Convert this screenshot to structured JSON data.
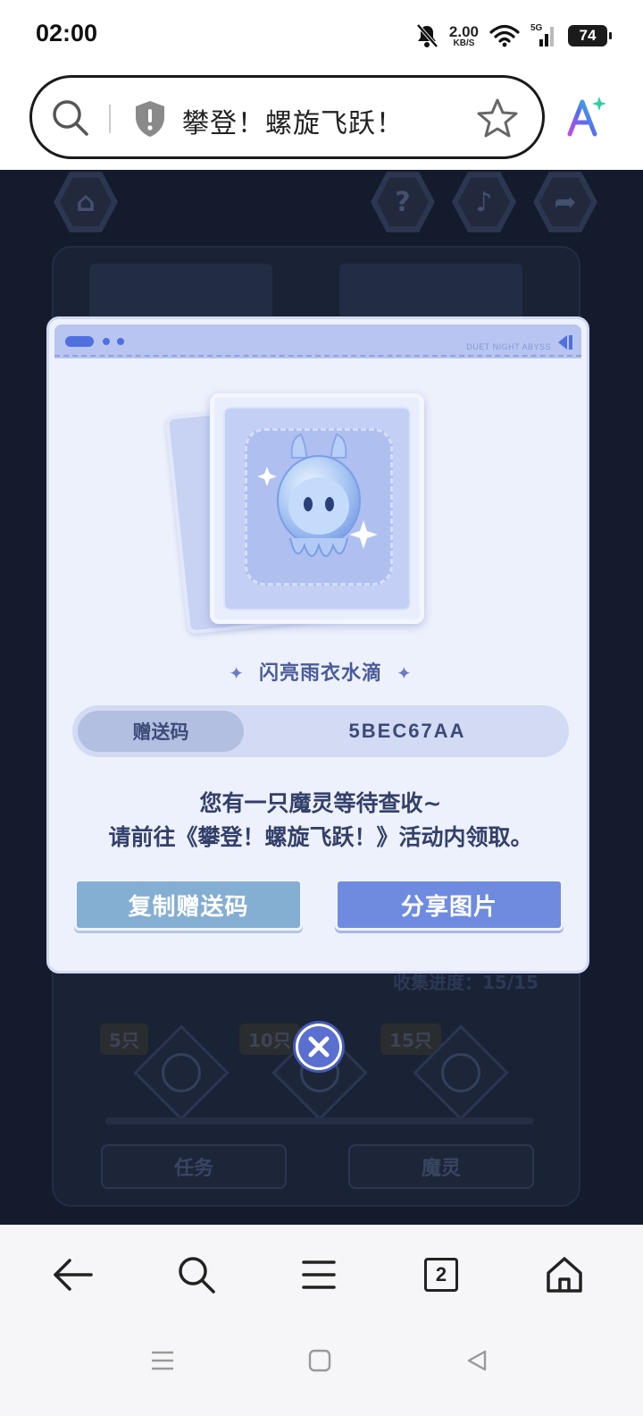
{
  "status_bar": {
    "time": "02:00",
    "net_speed": "2.00",
    "net_unit": "KB/S",
    "signal_label": "5G",
    "battery": "74"
  },
  "browser": {
    "page_title": "攀登！螺旋飞跃！",
    "icons": [
      "search-icon",
      "shield-icon",
      "star-icon",
      "ai-assistant-icon"
    ]
  },
  "game_background": {
    "top_icons": [
      "home-icon",
      "help-icon",
      "music-icon",
      "share-icon"
    ],
    "milestones": [
      "5只",
      "10只",
      "15只"
    ],
    "collect_progress": "收集进度：15/15",
    "tabs": [
      "任务",
      "魔灵"
    ]
  },
  "modal": {
    "brand": "DUET NIGHT ABYSS",
    "pet_name": "闪亮雨衣水滴",
    "code_label": "赠送码",
    "code_value": "5BEC67AA",
    "message_line1": "您有一只魔灵等待查收~",
    "message_line2": "请前往《攀登！螺旋飞跃！》活动内领取。",
    "copy_button": "复制赠送码",
    "share_button": "分享图片",
    "accent_color": "#6f8be0"
  },
  "bottom_nav": {
    "tab_count": "2",
    "items": [
      "back-icon",
      "search-icon",
      "menu-icon",
      "tabs-icon",
      "home-icon"
    ]
  }
}
